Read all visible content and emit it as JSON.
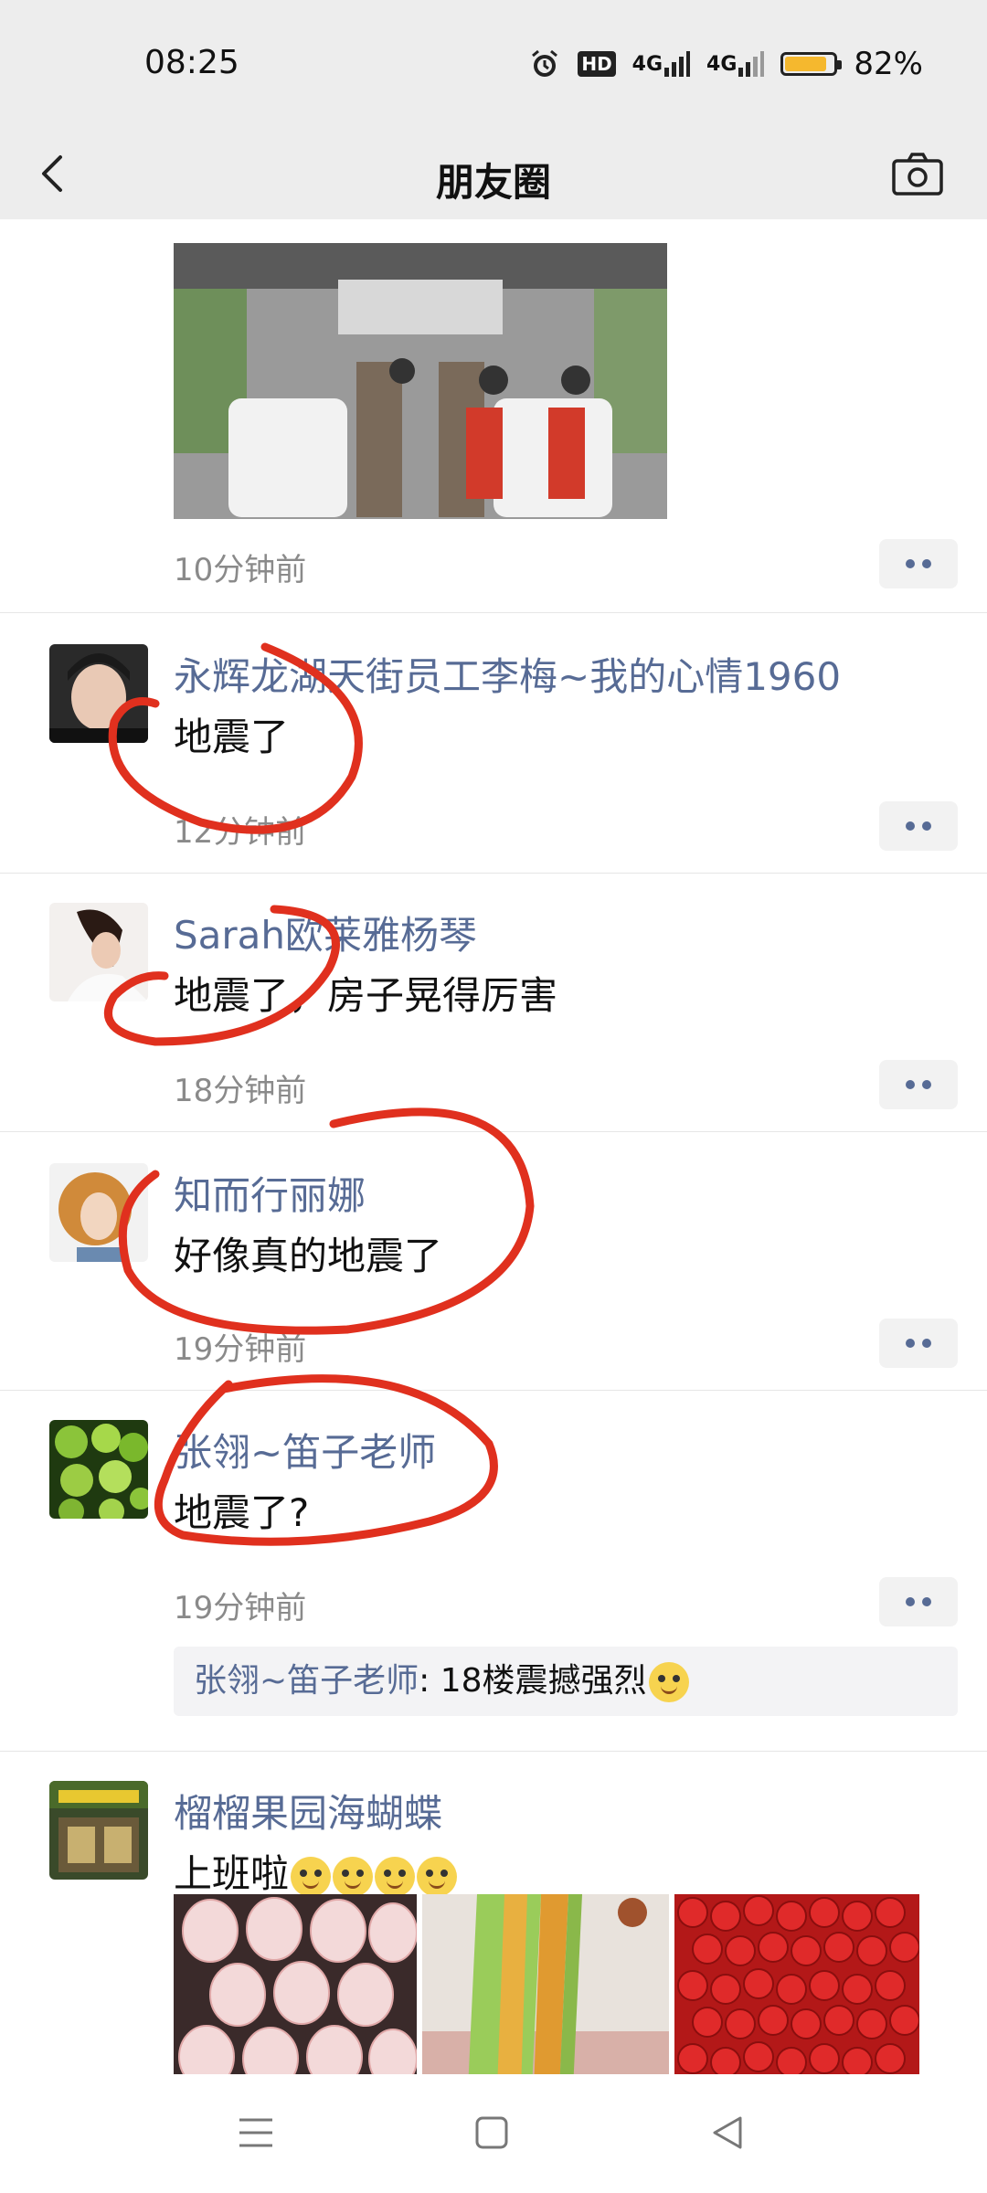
{
  "status": {
    "time": "08:25",
    "battery_pct": "82%",
    "battery_level": 0.82,
    "battery_color": "#f5b82e",
    "hd_badge": "HD",
    "network_1": "4G",
    "network_2": "4G",
    "icons": [
      "alarm-icon",
      "hd-icon",
      "signal-icon",
      "signal-icon",
      "battery-icon"
    ]
  },
  "nav": {
    "title": "朋友圈",
    "back_icon": "chevron-left-icon",
    "camera_icon": "camera-icon"
  },
  "accent_color": "#576b95",
  "annotation_color": "#e0301e",
  "posts": [
    {
      "time": "10分钟前",
      "image": "bus-interior-photo"
    },
    {
      "author": "永辉龙湖天街员工李梅~我的心情1960",
      "text": "地震了",
      "time": "12分钟前"
    },
    {
      "author": "Sarah欧莱雅杨琴",
      "text": "地震了，房子晃得厉害",
      "time": "18分钟前"
    },
    {
      "author": "知而行丽娜",
      "text": "好像真的地震了",
      "time": "19分钟前"
    },
    {
      "author": "张翎~笛子老师",
      "text": "地震了?",
      "time": "19分钟前",
      "comment": {
        "name": "张翎~笛子老师",
        "text": ": 18楼震撼强烈",
        "emoji": "laugh-cry-emoji"
      }
    },
    {
      "author": "榴榴果园海蝴蝶",
      "text": "上班啦",
      "emoji_count": 4,
      "emoji": "smile-emoji",
      "images": [
        "white-strawberries-photo",
        "cake-roll-photo",
        "red-strawberries-photo"
      ]
    }
  ],
  "system_nav": {
    "menu_icon": "menu-icon",
    "home_icon": "home-square-icon",
    "back_icon": "back-triangle-icon"
  }
}
